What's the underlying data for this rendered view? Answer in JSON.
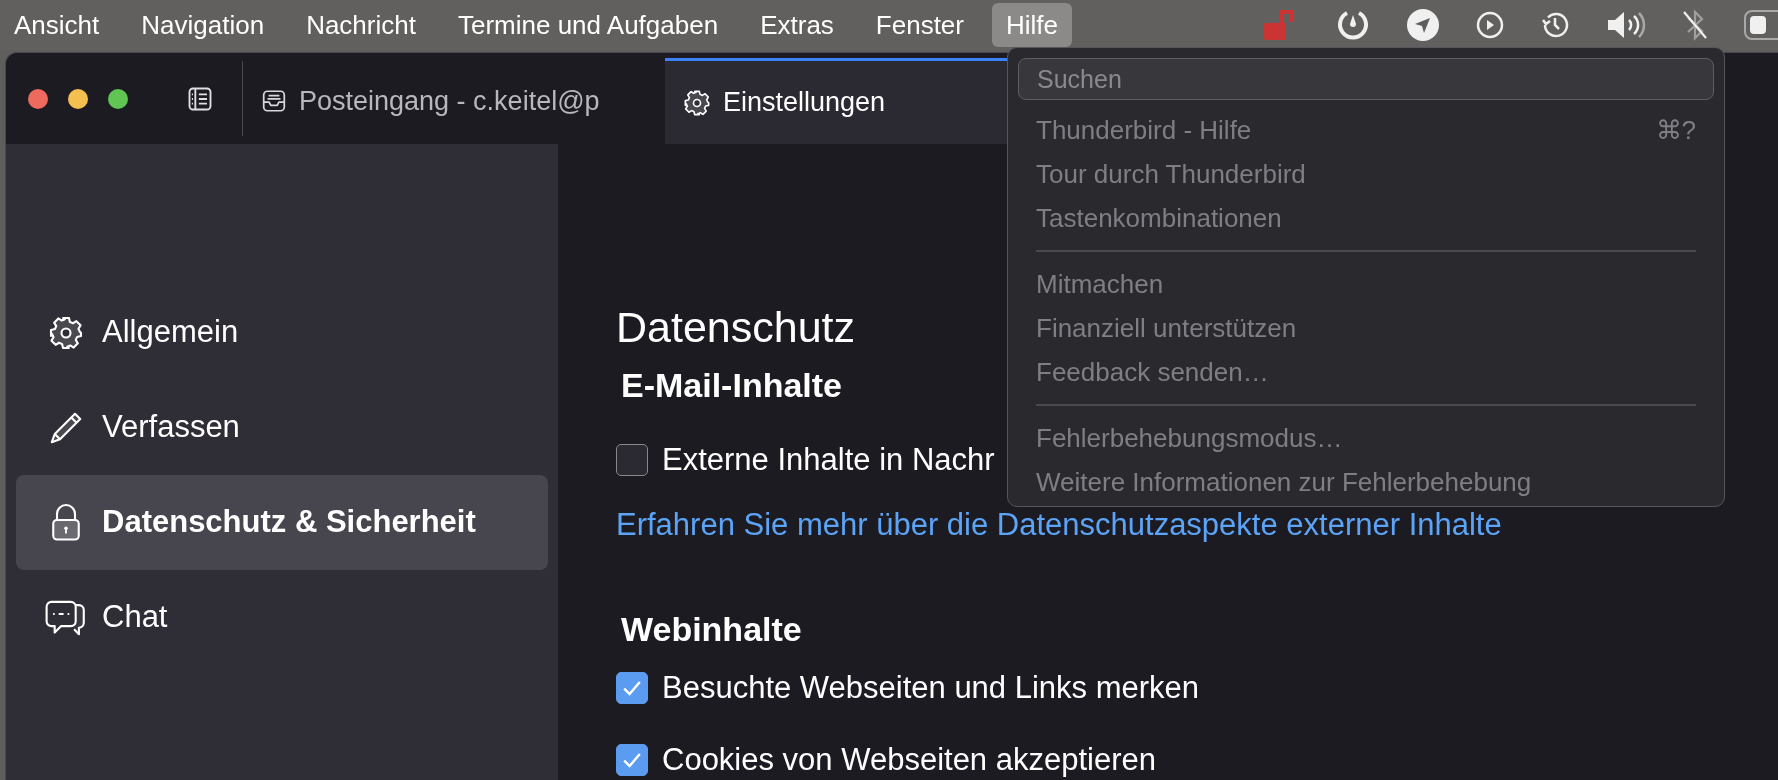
{
  "menu_bar": {
    "items": [
      {
        "label": "Ansicht",
        "selected": false
      },
      {
        "label": "Navigation",
        "selected": false
      },
      {
        "label": "Nachricht",
        "selected": false
      },
      {
        "label": "Termine und Aufgaben",
        "selected": false
      },
      {
        "label": "Extras",
        "selected": false
      },
      {
        "label": "Fenster",
        "selected": false
      },
      {
        "label": "Hilfe",
        "selected": true
      }
    ]
  },
  "window": {
    "tabs": [
      {
        "label": "Posteingang - c.keitel@p",
        "selected": false
      },
      {
        "label": "Einstellungen",
        "selected": true
      }
    ]
  },
  "sidebar": {
    "items": [
      {
        "label": "Allgemein",
        "selected": false
      },
      {
        "label": "Verfassen",
        "selected": false
      },
      {
        "label": "Datenschutz & Sicherheit",
        "selected": true
      },
      {
        "label": "Chat",
        "selected": false
      }
    ]
  },
  "content": {
    "title": "Datenschutz",
    "sections": [
      {
        "heading": "E-Mail-Inhalte",
        "rows": [
          {
            "kind": "checkbox",
            "label": "Externe Inhalte in Nachr",
            "checked": false
          },
          {
            "kind": "link",
            "label": "Erfahren Sie mehr über die Datenschutzaspekte externer Inhalte"
          }
        ]
      },
      {
        "heading": "Webinhalte",
        "rows": [
          {
            "kind": "checkbox",
            "label": "Besuchte Webseiten und Links merken",
            "checked": true
          },
          {
            "kind": "checkbox",
            "label": "Cookies von Webseiten akzeptieren",
            "checked": true
          }
        ]
      }
    ]
  },
  "help_menu": {
    "search": {
      "placeholder": "Suchen"
    },
    "groups": [
      {
        "items": [
          {
            "label": "Thunderbird - Hilfe",
            "shortcut": "⌘?",
            "disabled": true
          },
          {
            "label": "Tour durch Thunderbird",
            "disabled": true
          },
          {
            "label": "Tastenkombinationen",
            "disabled": true
          }
        ]
      },
      {
        "items": [
          {
            "label": "Mitmachen",
            "disabled": true
          },
          {
            "label": "Finanziell unterstützen",
            "disabled": true
          },
          {
            "label": "Feedback senden…",
            "disabled": true
          }
        ]
      },
      {
        "items": [
          {
            "label": "Fehlerbehebungsmodus…",
            "disabled": true
          },
          {
            "label": "Weitere Informationen zur Fehlerbehebung",
            "disabled": true
          }
        ]
      }
    ]
  }
}
